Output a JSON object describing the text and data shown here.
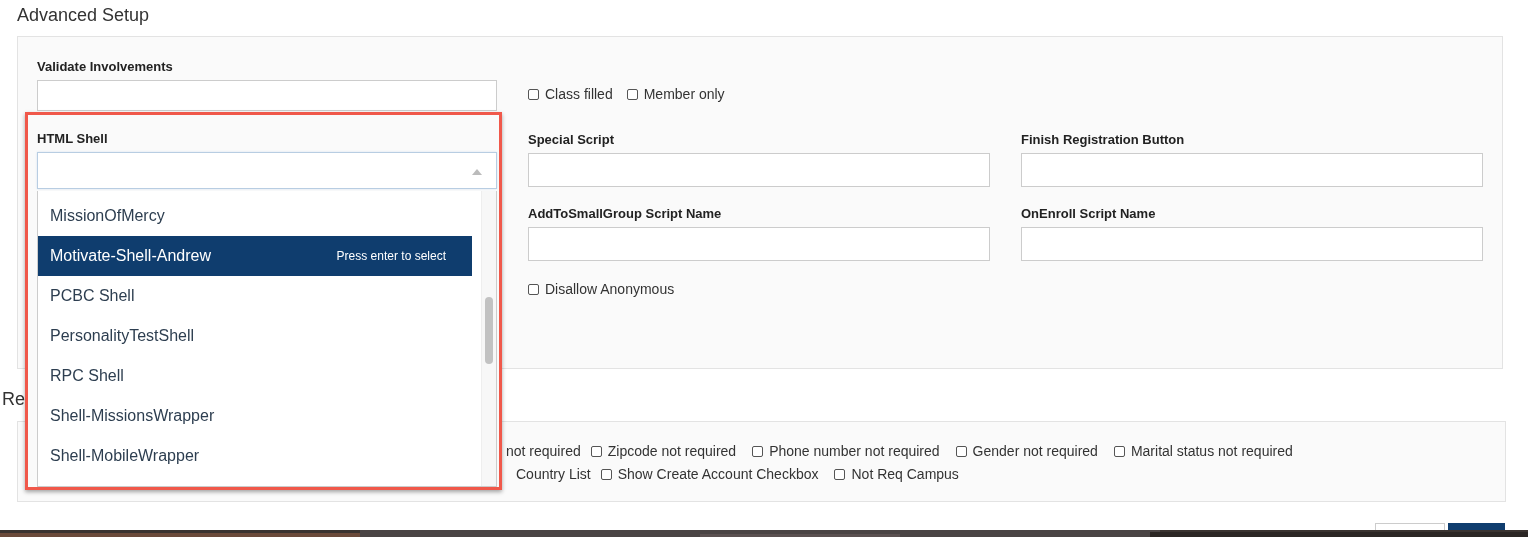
{
  "title": "Advanced Setup",
  "advanced": {
    "validate": {
      "label": "Validate Involvements"
    },
    "checkboxes": [
      {
        "label": "Class filled",
        "checked": false
      },
      {
        "label": "Member only",
        "checked": false
      }
    ],
    "html_shell": {
      "label": "HTML Shell",
      "expanded": true,
      "hint": "Press enter to select",
      "options": [
        {
          "label": "MissionOfMercy",
          "selected": false
        },
        {
          "label": "Motivate-Shell-Andrew",
          "selected": true
        },
        {
          "label": "PCBC Shell",
          "selected": false
        },
        {
          "label": "PersonalityTestShell",
          "selected": false
        },
        {
          "label": "RPC Shell",
          "selected": false
        },
        {
          "label": "Shell-MissionsWrapper",
          "selected": false
        },
        {
          "label": "Shell-MobileWrapper",
          "selected": false
        }
      ]
    },
    "fields": [
      {
        "label": "Special Script"
      },
      {
        "label": "Finish Registration Button"
      },
      {
        "label": "AddToSmallGroup Script Name"
      },
      {
        "label": "OnEnroll Script Name"
      }
    ],
    "disallow": {
      "label": "Disallow Anonymous",
      "checked": false
    }
  },
  "registration": {
    "title": "Re",
    "rows": [
      [
        {
          "kind": "fragment",
          "label": "not required"
        },
        {
          "kind": "checkbox",
          "label": "Zipcode not required",
          "checked": false
        },
        {
          "kind": "checkbox",
          "label": "Phone number not required",
          "checked": false
        },
        {
          "kind": "checkbox",
          "label": "Gender not required",
          "checked": false
        },
        {
          "kind": "checkbox",
          "label": "Marital status not required",
          "checked": false
        }
      ],
      [
        {
          "kind": "fragment",
          "label": "Country List"
        },
        {
          "kind": "checkbox",
          "label": "Show Create Account Checkbox",
          "checked": false
        },
        {
          "kind": "checkbox",
          "label": "Not Req Campus",
          "checked": false
        }
      ]
    ]
  }
}
